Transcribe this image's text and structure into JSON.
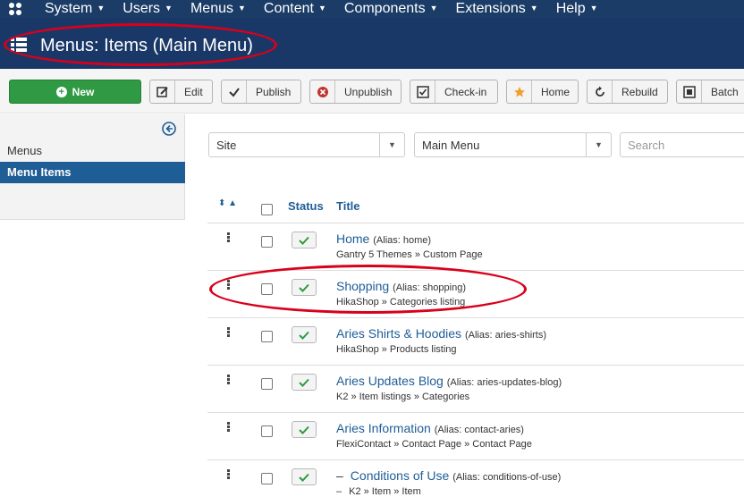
{
  "topnav": {
    "items": [
      {
        "label": "System"
      },
      {
        "label": "Users"
      },
      {
        "label": "Menus"
      },
      {
        "label": "Content"
      },
      {
        "label": "Components"
      },
      {
        "label": "Extensions"
      },
      {
        "label": "Help"
      }
    ]
  },
  "header": {
    "title": "Menus: Items (Main Menu)"
  },
  "toolbar": {
    "new": "New",
    "edit": "Edit",
    "publish": "Publish",
    "unpublish": "Unpublish",
    "checkin": "Check-in",
    "home": "Home",
    "rebuild": "Rebuild",
    "batch": "Batch"
  },
  "sidebar": {
    "menus": "Menus",
    "menu_items": "Menu Items"
  },
  "filters": {
    "client": "Site",
    "menu": "Main Menu",
    "search_placeholder": "Search"
  },
  "table": {
    "headers": {
      "status": "Status",
      "title": "Title"
    },
    "rows": [
      {
        "title": "Home",
        "alias": "(Alias: home)",
        "type": "Gantry 5 Themes » Custom Page"
      },
      {
        "title": "Shopping",
        "alias": "(Alias: shopping)",
        "type": "HikaShop » Categories listing"
      },
      {
        "title": "Aries Shirts & Hoodies",
        "alias": "(Alias: aries-shirts)",
        "type": "HikaShop » Products listing"
      },
      {
        "title": "Aries Updates Blog",
        "alias": "(Alias: aries-updates-blog)",
        "type": "K2 » Item listings » Categories"
      },
      {
        "title": "Aries Information",
        "alias": "(Alias: contact-aries)",
        "type": "FlexiContact » Contact Page » Contact Page"
      },
      {
        "title": "Conditions of Use",
        "alias": "(Alias: conditions-of-use)",
        "type": "K2 » Item » Item",
        "prefix": "–"
      }
    ]
  },
  "colors": {
    "nav_bg": "#1b3c67",
    "accent": "#1f5d96",
    "new_button": "#2f9a43",
    "annotation": "#d9001b"
  }
}
